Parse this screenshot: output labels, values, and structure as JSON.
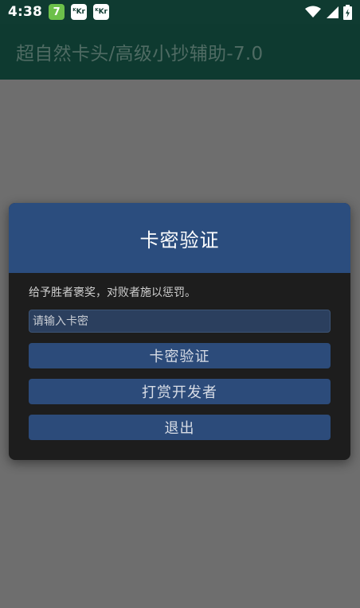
{
  "status_bar": {
    "time": "4:38",
    "notification_icons": [
      {
        "name": "green-app-notification-icon",
        "glyph": "7"
      },
      {
        "name": "kr-app-notification-icon",
        "glyph": "ᴷKr"
      },
      {
        "name": "kr-app-notification-icon-2",
        "glyph": "ᴷKr"
      }
    ],
    "system_icons": [
      "wifi-icon",
      "cell-signal-icon",
      "battery-charging-icon"
    ]
  },
  "app_bar": {
    "title": "超自然卡头/高级小抄辅助-7.0"
  },
  "dialog": {
    "title": "卡密验证",
    "message": "给予胜者褒奖，对败者施以惩罚。",
    "input": {
      "placeholder": "请输入卡密",
      "value": ""
    },
    "buttons": {
      "verify": "卡密验证",
      "reward": "打赏开发者",
      "exit": "退出"
    }
  },
  "colors": {
    "status_bar_bg": "#0f3b31",
    "app_bar_bg": "#0e3a30",
    "overlay_bg": "#6e6e6e",
    "dialog_bg": "#1d1d1d",
    "dialog_header_bg": "#2b4d7e",
    "button_bg": "#2c4b7a"
  }
}
